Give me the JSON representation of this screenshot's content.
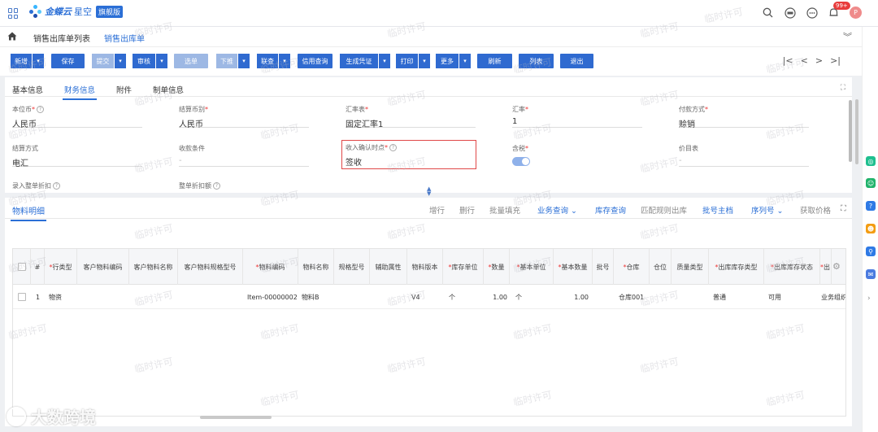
{
  "header": {
    "brand_name": "金蝶云",
    "brand_product": "星空",
    "brand_edition": "旗舰版",
    "notification_count": "99+",
    "avatar_letter": "P"
  },
  "tabs": [
    {
      "label": "销售出库单列表"
    },
    {
      "label": "销售出库单",
      "active": true
    }
  ],
  "toolbar": {
    "buttons": [
      {
        "label": "新增",
        "type": "split"
      },
      {
        "label": "保存",
        "type": "plain"
      },
      {
        "label": "提交",
        "type": "split",
        "disabled": true
      },
      {
        "label": "审核",
        "type": "split"
      },
      {
        "label": "选单",
        "type": "plain",
        "disabled": true
      },
      {
        "label": "下推",
        "type": "split",
        "disabled": true
      },
      {
        "label": "联查",
        "type": "split"
      },
      {
        "label": "信用查询",
        "type": "plain"
      },
      {
        "label": "生成凭证",
        "type": "split"
      },
      {
        "label": "打印",
        "type": "split"
      },
      {
        "label": "更多",
        "type": "split"
      },
      {
        "label": "刷新",
        "type": "plain"
      },
      {
        "label": "列表",
        "type": "plain"
      },
      {
        "label": "退出",
        "type": "plain"
      }
    ],
    "pager": [
      "|<",
      "<",
      ">",
      ">|"
    ]
  },
  "form": {
    "subtabs": [
      {
        "label": "基本信息"
      },
      {
        "label": "财务信息",
        "active": true
      },
      {
        "label": "附件"
      },
      {
        "label": "制单信息"
      }
    ],
    "fields": [
      {
        "label": "本位币",
        "required": true,
        "help": true,
        "value": "人民币"
      },
      {
        "label": "结算币别",
        "required": true,
        "value": "人民币"
      },
      {
        "label": "汇率表",
        "required": true,
        "value": "固定汇率1"
      },
      {
        "label": "汇率",
        "required": true,
        "value": "1"
      },
      {
        "label": "付款方式",
        "required": true,
        "value": "赊销"
      },
      {
        "label": "结算方式",
        "value": "电汇"
      },
      {
        "label": "收款条件",
        "value": "-"
      },
      {
        "label": "收入确认时点",
        "required": true,
        "help": true,
        "value": "签收",
        "highlighted": true
      },
      {
        "label": "含税",
        "required": true,
        "toggle": true,
        "checked": true
      },
      {
        "label": "价目表",
        "value": "-"
      },
      {
        "label": "录入整单折扣",
        "help": true,
        "value": ""
      },
      {
        "label": "整单折扣额",
        "help": true,
        "value": ""
      }
    ]
  },
  "detail": {
    "title": "物料明细",
    "actions": [
      {
        "label": "增行",
        "link": false
      },
      {
        "label": "删行",
        "link": false
      },
      {
        "label": "批量填充",
        "link": false
      },
      {
        "label": "业务查询",
        "link": true,
        "dropdown": true
      },
      {
        "label": "库存查询",
        "link": true
      },
      {
        "label": "匹配规则出库",
        "link": false
      },
      {
        "label": "批号主档",
        "link": true
      },
      {
        "label": "序列号",
        "link": true,
        "dropdown": true
      },
      {
        "label": "获取价格",
        "link": false
      }
    ],
    "columns": [
      {
        "label": "#",
        "required": false
      },
      {
        "label": "行类型",
        "required": true
      },
      {
        "label": "客户物料编码",
        "required": false
      },
      {
        "label": "客户物料名称",
        "required": false
      },
      {
        "label": "客户物料规格型号",
        "required": false
      },
      {
        "label": "物料编码",
        "required": true
      },
      {
        "label": "物料名称",
        "required": false
      },
      {
        "label": "规格型号",
        "required": false
      },
      {
        "label": "辅助属性",
        "required": false
      },
      {
        "label": "物料版本",
        "required": false
      },
      {
        "label": "库存单位",
        "required": true
      },
      {
        "label": "数量",
        "required": true
      },
      {
        "label": "基本单位",
        "required": true
      },
      {
        "label": "基本数量",
        "required": true
      },
      {
        "label": "批号",
        "required": false
      },
      {
        "label": "仓库",
        "required": true
      },
      {
        "label": "仓位",
        "required": false
      },
      {
        "label": "质量类型",
        "required": false
      },
      {
        "label": "出库库存类型",
        "required": true
      },
      {
        "label": "出库库存状态",
        "required": true
      },
      {
        "label": "出",
        "required": true
      }
    ],
    "rows": [
      {
        "cells": [
          "1",
          "物资",
          "",
          "",
          "",
          "Item-00000002",
          "物料B",
          "",
          "",
          "V4",
          "个",
          "1.00",
          "个",
          "1.00",
          "",
          "仓库001",
          "",
          "",
          "普通",
          "可用",
          "业务组织"
        ]
      }
    ]
  },
  "watermark": "临时许可",
  "overlay_brand": "大数跨境"
}
